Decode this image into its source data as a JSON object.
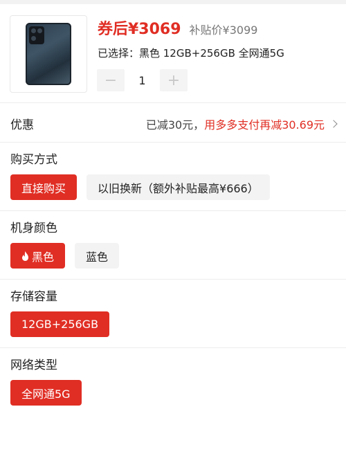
{
  "product": {
    "price_label": "券后¥3069",
    "subsidy_price": "补贴价¥3099",
    "selected_text": "已选择：黑色 12GB+256GB 全网通5G",
    "quantity": "1",
    "minus_symbol": "−",
    "plus_symbol": "+"
  },
  "discount": {
    "label": "优惠",
    "reduced": "已减30元，",
    "promo": "用多多支付再减30.69元"
  },
  "purchase_method": {
    "title": "购买方式",
    "options": [
      "直接购买",
      "以旧换新（额外补贴最高¥666）"
    ]
  },
  "color": {
    "title": "机身颜色",
    "options": [
      "黑色",
      "蓝色"
    ]
  },
  "storage": {
    "title": "存储容量",
    "options": [
      "12GB+256GB"
    ]
  },
  "network": {
    "title": "网络类型",
    "options": [
      "全网通5G"
    ]
  },
  "colors": {
    "accent": "#e02e24",
    "inactive_bg": "#f3f3f3",
    "divider": "#ececec"
  },
  "icons": {
    "flame": "flame-icon",
    "chevron": "chevron-right-icon"
  }
}
